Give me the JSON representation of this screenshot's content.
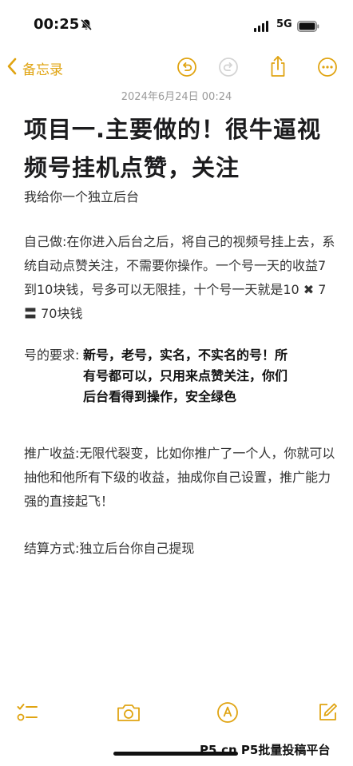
{
  "status_bar": {
    "time": "00:25",
    "network": "5G"
  },
  "nav": {
    "back_label": "备忘录"
  },
  "note": {
    "date": "2024年6月24日 00:24",
    "title": "项目一.主要做的！很牛逼视频号挂机点赞，关注",
    "intro": "我给你一个独立后台",
    "para1": "自己做:在你进入后台之后，将自己的视频号挂上去，系统自动点赞关注，不需要你操作。一个号一天的收益7到10块钱，号多可以无限挂，十个号一天就是10 ✖ 7 〓 70块钱",
    "requirement_label": "号的要求:",
    "requirement_text": "新号，老号，实名，不实名的号！所有号都可以，只用来点赞关注，你们后台看得到操作，安全绿色",
    "promotion": "推广收益:无限代裂变，比如你推广了一个人，你就可以抽他和他所有下级的收益，抽成你自己设置，推广能力强的直接起飞！",
    "settlement": "结算方式:独立后台你自己提现"
  },
  "watermark": "P5.cn P5批量投稿平台",
  "colors": {
    "accent": "#e0a412"
  }
}
